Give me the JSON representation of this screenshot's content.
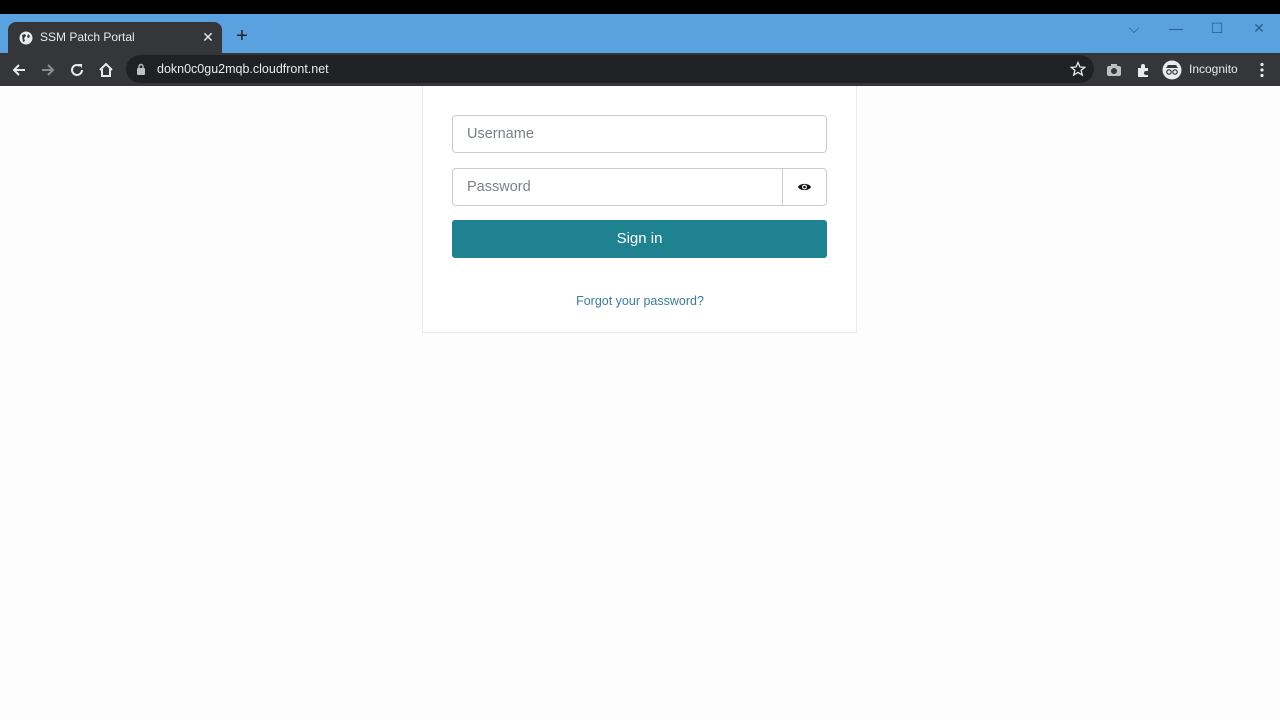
{
  "browser": {
    "tab_title": "SSM Patch Portal",
    "url": "dokn0c0gu2mqb.cloudfront.net",
    "profile_label": "Incognito"
  },
  "login": {
    "username_placeholder": "Username",
    "password_placeholder": "Password",
    "signin_label": "Sign in",
    "forgot_label": "Forgot your password?"
  },
  "colors": {
    "tabbar": "#59a2df",
    "toolbar": "#35363a",
    "primary_button": "#1f8290",
    "link": "#3b7c98"
  }
}
